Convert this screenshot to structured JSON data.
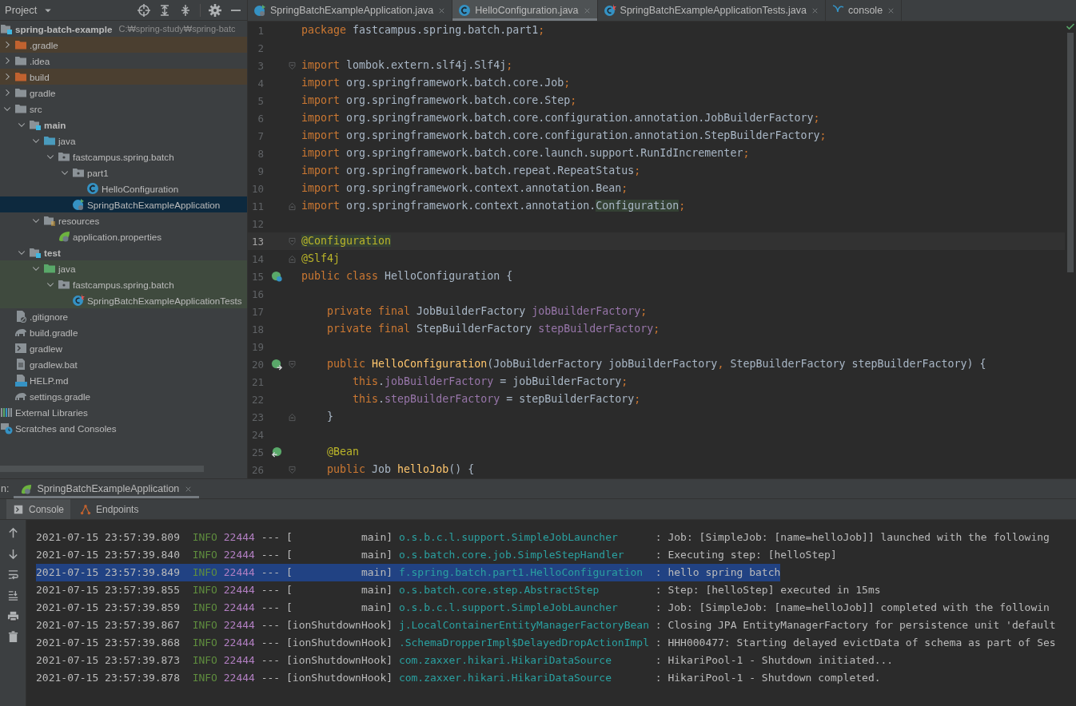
{
  "project_panel": {
    "title": "Project",
    "tree": [
      {
        "label": "spring-batch-example",
        "path": "C:₩spring-study₩spring-batc",
        "kind": "module",
        "selected": false,
        "children": [
          {
            "label": ".gradle",
            "kind": "folder-excluded",
            "expanded": false,
            "selected": false
          },
          {
            "label": ".idea",
            "kind": "folder",
            "expanded": false,
            "selected": false
          },
          {
            "label": "build",
            "kind": "folder-excluded",
            "expanded": false,
            "selected": false
          },
          {
            "label": "gradle",
            "kind": "folder",
            "expanded": false,
            "selected": false
          },
          {
            "label": "src",
            "kind": "folder",
            "expanded": true,
            "selected": false,
            "children": [
              {
                "label": "main",
                "kind": "module",
                "expanded": true,
                "selected": false,
                "children": [
                  {
                    "label": "java",
                    "kind": "source-root",
                    "expanded": true,
                    "selected": false,
                    "children": [
                      {
                        "label": "fastcampus.spring.batch",
                        "kind": "package",
                        "expanded": true,
                        "selected": false,
                        "children": [
                          {
                            "label": "part1",
                            "kind": "package",
                            "expanded": true,
                            "selected": false,
                            "children": [
                              {
                                "label": "HelloConfiguration",
                                "kind": "class",
                                "selected": false
                              }
                            ]
                          },
                          {
                            "label": "SpringBatchExampleApplication",
                            "kind": "spring-app",
                            "selected": true
                          }
                        ]
                      }
                    ]
                  },
                  {
                    "label": "resources",
                    "kind": "resources-root",
                    "expanded": true,
                    "selected": false,
                    "children": [
                      {
                        "label": "application.properties",
                        "kind": "spring-props",
                        "selected": false
                      }
                    ]
                  }
                ]
              },
              {
                "label": "test",
                "kind": "module",
                "expanded": true,
                "selected": false,
                "children": [
                  {
                    "label": "java",
                    "kind": "test-root",
                    "expanded": true,
                    "selected": false,
                    "children": [
                      {
                        "label": "fastcampus.spring.batch",
                        "kind": "test-package",
                        "expanded": true,
                        "selected": false,
                        "children": [
                          {
                            "label": "SpringBatchExampleApplicationTests",
                            "kind": "spring-test",
                            "selected": false
                          }
                        ]
                      }
                    ]
                  }
                ]
              }
            ]
          },
          {
            "label": ".gitignore",
            "kind": "gitignore",
            "selected": false
          },
          {
            "label": "build.gradle",
            "kind": "gradle",
            "selected": false
          },
          {
            "label": "gradlew",
            "kind": "shell",
            "selected": false
          },
          {
            "label": "gradlew.bat",
            "kind": "text-file",
            "selected": false
          },
          {
            "label": "HELP.md",
            "kind": "markdown",
            "selected": false
          },
          {
            "label": "settings.gradle",
            "kind": "gradle",
            "selected": false
          }
        ]
      },
      {
        "label": "External Libraries",
        "kind": "libraries",
        "selected": false
      },
      {
        "label": "Scratches and Consoles",
        "kind": "scratches",
        "selected": false
      }
    ]
  },
  "editor": {
    "tabs": [
      {
        "label": "SpringBatchExampleApplication.java",
        "kind": "spring-app",
        "selected": false
      },
      {
        "label": "HelloConfiguration.java",
        "kind": "class",
        "selected": true
      },
      {
        "label": "SpringBatchExampleApplicationTests.java",
        "kind": "spring-test",
        "selected": false
      },
      {
        "label": "console",
        "kind": "tab-console",
        "selected": false
      }
    ],
    "lines": [
      {
        "number": "1",
        "current": false,
        "tokens": [
          {
            "kind": "kw",
            "text": "package"
          },
          {
            "kind": "plain",
            "text": " fastcampus.spring.batch.part1"
          },
          {
            "kind": "kw",
            "text": ";"
          }
        ]
      },
      {
        "number": "2",
        "current": false
      },
      {
        "number": "3",
        "current": false,
        "fold": {
          "kind": "start"
        },
        "tokens": [
          {
            "kind": "kw",
            "text": "import"
          },
          {
            "kind": "plain",
            "text": " lombok.extern.slf4j.Slf4j"
          },
          {
            "kind": "kw",
            "text": ";"
          }
        ]
      },
      {
        "number": "4",
        "current": false,
        "tokens": [
          {
            "kind": "kw",
            "text": "import"
          },
          {
            "kind": "plain",
            "text": " org.springframework.batch.core.Job"
          },
          {
            "kind": "kw",
            "text": ";"
          }
        ]
      },
      {
        "number": "5",
        "current": false,
        "tokens": [
          {
            "kind": "kw",
            "text": "import"
          },
          {
            "kind": "plain",
            "text": " org.springframework.batch.core.Step"
          },
          {
            "kind": "kw",
            "text": ";"
          }
        ]
      },
      {
        "number": "6",
        "current": false,
        "tokens": [
          {
            "kind": "kw",
            "text": "import"
          },
          {
            "kind": "plain",
            "text": " org.springframework.batch.core.configuration.annotation.JobBuilderFactory"
          },
          {
            "kind": "kw",
            "text": ";"
          }
        ]
      },
      {
        "number": "7",
        "current": false,
        "tokens": [
          {
            "kind": "kw",
            "text": "import"
          },
          {
            "kind": "plain",
            "text": " org.springframework.batch.core.configuration.annotation.StepBuilderFactory"
          },
          {
            "kind": "kw",
            "text": ";"
          }
        ]
      },
      {
        "number": "8",
        "current": false,
        "tokens": [
          {
            "kind": "kw",
            "text": "import"
          },
          {
            "kind": "plain",
            "text": " org.springframework.batch.core.launch.support.RunIdIncrementer"
          },
          {
            "kind": "kw",
            "text": ";"
          }
        ]
      },
      {
        "number": "9",
        "current": false,
        "tokens": [
          {
            "kind": "kw",
            "text": "import"
          },
          {
            "kind": "plain",
            "text": " org.springframework.batch.repeat.RepeatStatus"
          },
          {
            "kind": "kw",
            "text": ";"
          }
        ]
      },
      {
        "number": "10",
        "current": false,
        "tokens": [
          {
            "kind": "kw",
            "text": "import"
          },
          {
            "kind": "plain",
            "text": " org.springframework.context.annotation.Bean"
          },
          {
            "kind": "kw",
            "text": ";"
          }
        ]
      },
      {
        "number": "11",
        "current": false,
        "fold": {
          "kind": "end"
        },
        "tokens": [
          {
            "kind": "kw",
            "text": "import"
          },
          {
            "kind": "plain",
            "text": " org.springframework.context.annotation."
          },
          {
            "kind": "match",
            "text": "Configuration"
          },
          {
            "kind": "kw",
            "text": ";"
          }
        ]
      },
      {
        "number": "12",
        "current": false
      },
      {
        "number": "13",
        "current": true,
        "fold": {
          "kind": "start"
        },
        "tokens": [
          {
            "kind": "ann-match",
            "text": "@Configuration"
          }
        ]
      },
      {
        "number": "14",
        "current": false,
        "fold": {
          "kind": "end"
        },
        "tokens": [
          {
            "kind": "ann",
            "text": "@Slf4j"
          }
        ]
      },
      {
        "number": "15",
        "current": false,
        "gutter_icon": {
          "kind": "bean-class"
        },
        "tokens": [
          {
            "kind": "kw",
            "text": "public class"
          },
          {
            "kind": "plain",
            "text": " HelloConfiguration {"
          }
        ]
      },
      {
        "number": "16",
        "current": false
      },
      {
        "number": "17",
        "current": false,
        "tokens": [
          {
            "kind": "kw",
            "text": "    private final"
          },
          {
            "kind": "plain",
            "text": " JobBuilderFactory "
          },
          {
            "kind": "field",
            "text": "jobBuilderFactory"
          },
          {
            "kind": "kw",
            "text": ";"
          }
        ]
      },
      {
        "number": "18",
        "current": false,
        "tokens": [
          {
            "kind": "kw",
            "text": "    private final"
          },
          {
            "kind": "plain",
            "text": " StepBuilderFactory "
          },
          {
            "kind": "field",
            "text": "stepBuilderFactory"
          },
          {
            "kind": "kw",
            "text": ";"
          }
        ]
      },
      {
        "number": "19",
        "current": false
      },
      {
        "number": "20",
        "current": false,
        "gutter_icon": {
          "kind": "bean-inject"
        },
        "fold": {
          "kind": "start"
        },
        "tokens": [
          {
            "kind": "kw",
            "text": "    public "
          },
          {
            "kind": "fn",
            "text": "HelloConfiguration"
          },
          {
            "kind": "plain",
            "text": "(JobBuilderFactory jobBuilderFactory"
          },
          {
            "kind": "kw",
            "text": ","
          },
          {
            "kind": "plain",
            "text": " StepBuilderFactory stepBuilderFactory) {"
          }
        ]
      },
      {
        "number": "21",
        "current": false,
        "tokens": [
          {
            "kind": "kw",
            "text": "        this"
          },
          {
            "kind": "plain",
            "text": "."
          },
          {
            "kind": "field",
            "text": "jobBuilderFactory"
          },
          {
            "kind": "plain",
            "text": " = jobBuilderFactory"
          },
          {
            "kind": "kw",
            "text": ";"
          }
        ]
      },
      {
        "number": "22",
        "current": false,
        "tokens": [
          {
            "kind": "kw",
            "text": "        this"
          },
          {
            "kind": "plain",
            "text": "."
          },
          {
            "kind": "field",
            "text": "stepBuilderFactory"
          },
          {
            "kind": "plain",
            "text": " = stepBuilderFactory"
          },
          {
            "kind": "kw",
            "text": ";"
          }
        ]
      },
      {
        "number": "23",
        "current": false,
        "fold": {
          "kind": "end"
        },
        "tokens": [
          {
            "kind": "plain",
            "text": "    }"
          }
        ]
      },
      {
        "number": "24",
        "current": false
      },
      {
        "number": "25",
        "current": false,
        "gutter_icon": {
          "kind": "bean-nav"
        },
        "tokens": [
          {
            "kind": "ann",
            "text": "    @Bean"
          }
        ]
      },
      {
        "number": "26",
        "current": false,
        "fold": {
          "kind": "start"
        },
        "tokens": [
          {
            "kind": "kw",
            "text": "    public"
          },
          {
            "kind": "plain",
            "text": " Job "
          },
          {
            "kind": "fn",
            "text": "helloJob"
          },
          {
            "kind": "plain",
            "text": "() {"
          }
        ]
      }
    ]
  },
  "run_panel": {
    "prefix": "n:",
    "tabs": [
      {
        "label": "SpringBatchExampleApplication",
        "selected": true
      }
    ],
    "tool_tabs": [
      {
        "label": "Console",
        "kind": "console",
        "selected": true
      },
      {
        "label": "Endpoints",
        "kind": "endpoints",
        "selected": false
      }
    ],
    "lines": [
      {
        "time": "2021-07-15 23:57:39.809",
        "level": "INFO",
        "pid": "22444",
        "sep": "---",
        "thread": "[           main]",
        "logger": "o.s.b.c.l.support.SimpleJobLauncher",
        "message": ": Job: [SimpleJob: [name=helloJob]] launched with the following",
        "selected": false
      },
      {
        "time": "2021-07-15 23:57:39.840",
        "level": "INFO",
        "pid": "22444",
        "sep": "---",
        "thread": "[           main]",
        "logger": "o.s.batch.core.job.SimpleStepHandler",
        "message": ": Executing step: [helloStep]",
        "selected": false
      },
      {
        "time": "2021-07-15 23:57:39.849",
        "level": "INFO",
        "pid": "22444",
        "sep": "---",
        "thread": "[           main]",
        "logger": "f.spring.batch.part1.HelloConfiguration",
        "message": ": hello spring batch",
        "selected": true
      },
      {
        "time": "2021-07-15 23:57:39.855",
        "level": "INFO",
        "pid": "22444",
        "sep": "---",
        "thread": "[           main]",
        "logger": "o.s.batch.core.step.AbstractStep",
        "message": ": Step: [helloStep] executed in 15ms",
        "selected": false
      },
      {
        "time": "2021-07-15 23:57:39.859",
        "level": "INFO",
        "pid": "22444",
        "sep": "---",
        "thread": "[           main]",
        "logger": "o.s.b.c.l.support.SimpleJobLauncher",
        "message": ": Job: [SimpleJob: [name=helloJob]] completed with the followin",
        "selected": false
      },
      {
        "time": "2021-07-15 23:57:39.867",
        "level": "INFO",
        "pid": "22444",
        "sep": "---",
        "thread": "[ionShutdownHook]",
        "logger": "j.LocalContainerEntityManagerFactoryBean",
        "message": ": Closing JPA EntityManagerFactory for persistence unit 'default",
        "selected": false
      },
      {
        "time": "2021-07-15 23:57:39.868",
        "level": "INFO",
        "pid": "22444",
        "sep": "---",
        "thread": "[ionShutdownHook]",
        "logger": ".SchemaDropperImpl$DelayedDropActionImpl",
        "message": ": HHH000477: Starting delayed evictData of schema as part of Ses",
        "selected": false
      },
      {
        "time": "2021-07-15 23:57:39.873",
        "level": "INFO",
        "pid": "22444",
        "sep": "---",
        "thread": "[ionShutdownHook]",
        "logger": "com.zaxxer.hikari.HikariDataSource",
        "message": ": HikariPool-1 - Shutdown initiated...",
        "selected": false
      },
      {
        "time": "2021-07-15 23:57:39.878",
        "level": "INFO",
        "pid": "22444",
        "sep": "---",
        "thread": "[ionShutdownHook]",
        "logger": "com.zaxxer.hikari.HikariDataSource",
        "message": ": HikariPool-1 - Shutdown completed.",
        "selected": false
      }
    ]
  }
}
